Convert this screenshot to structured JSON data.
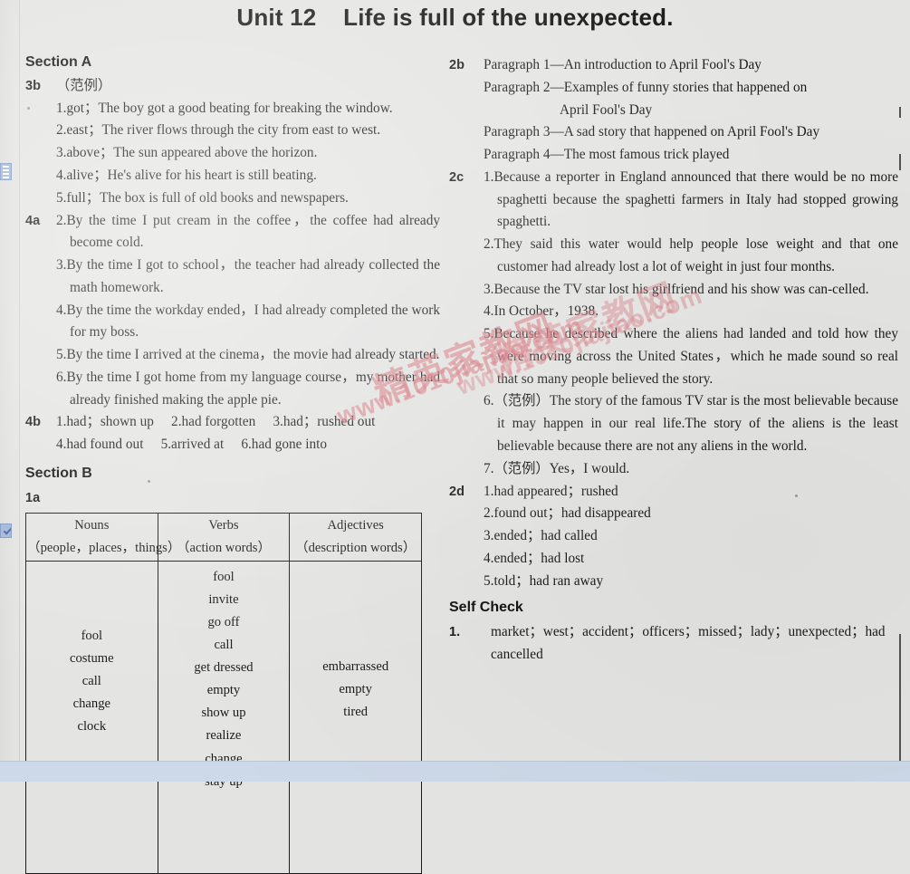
{
  "title": "Unit 12    Life is full of the unexpected.",
  "watermark": {
    "chinese": "精英家教网",
    "url": "www.1010jiajiao.com"
  },
  "left_column": {
    "section_a_heading": "Section A",
    "item_3b": {
      "key": "3b",
      "note": "（范例）",
      "answers": [
        "1.got；The boy got a good beating for breaking the window.",
        "2.east；The river flows through the city from east to west.",
        "3.above；The sun appeared above the horizon.",
        "4.alive；He's alive for his heart is still beating.",
        "5.full；The box is full of old books and newspapers."
      ]
    },
    "item_4a": {
      "key": "4a",
      "answers": [
        "2.By the time I put cream in the coffee，the coffee had already become cold.",
        "3.By the time I got to school，the teacher had already collected the math homework.",
        "4.By the time the workday ended，I had already completed the work for my boss.",
        "5.By the time I arrived at the cinema，the movie had already started.",
        "6.By the time I got home from my language course，my mother had already finished making the apple pie."
      ]
    },
    "item_4b": {
      "key": "4b",
      "answers": [
        "1.had；shown up　 2.had forgotten　 3.had；rushed out",
        "4.had found out　 5.arrived at　 6.had gone into"
      ]
    },
    "section_b_heading": "Section B",
    "item_1a_key": "1a",
    "table": {
      "headers": [
        {
          "line1": "Nouns",
          "line2": "（people，places，things）"
        },
        {
          "line1": "Verbs",
          "line2": "（action words）"
        },
        {
          "line1": "Adjectives",
          "line2": "（description words）"
        }
      ],
      "columns": [
        [
          "fool",
          "costume",
          "call",
          "change",
          "clock"
        ],
        [
          "fool",
          "invite",
          "go off",
          "call",
          "get dressed",
          "empty",
          "show up",
          "realize",
          "change",
          "stay up"
        ],
        [
          "embarrassed",
          "empty",
          "tired"
        ]
      ]
    }
  },
  "right_column": {
    "item_2b": {
      "key": "2b",
      "paragraphs": [
        "Paragraph 1—An introduction to April Fool's Day",
        "Paragraph 2—Examples of funny stories that happened on",
        "April Fool's Day",
        "Paragraph 3—A sad story that happened on April Fool's Day",
        "Paragraph 4—The most famous trick played"
      ]
    },
    "item_2c": {
      "key": "2c",
      "answers": [
        "1.Because a reporter in England announced that there would be no more spaghetti because the spaghetti farmers in Italy had stopped growing spaghetti.",
        "2.They said this water would help people lose weight and that one customer had already lost a lot of weight in just four months.",
        "3.Because the TV star lost his girlfriend and his show was can-celled.",
        "4.In October，1938.",
        "5.Because he described where the aliens had landed and told how they were moving across the United States，which he made sound so real that so many people believed the story.",
        "6.（范例）The story of the famous TV star is the most believable because it may happen in our real life.The story of the aliens is the least believable because there are not any aliens in the world.",
        "7.（范例）Yes，I would."
      ]
    },
    "item_2d": {
      "key": "2d",
      "answers": [
        "1.had appeared；rushed",
        "2.found out；had disappeared",
        "3.ended；had called",
        "4.ended；had lost",
        "5.told；had ran away"
      ]
    },
    "self_check_heading": "Self Check",
    "self_check": {
      "key": "1.",
      "answer": "market；west；accident；officers；missed；lady；unexpected；had cancelled"
    }
  }
}
